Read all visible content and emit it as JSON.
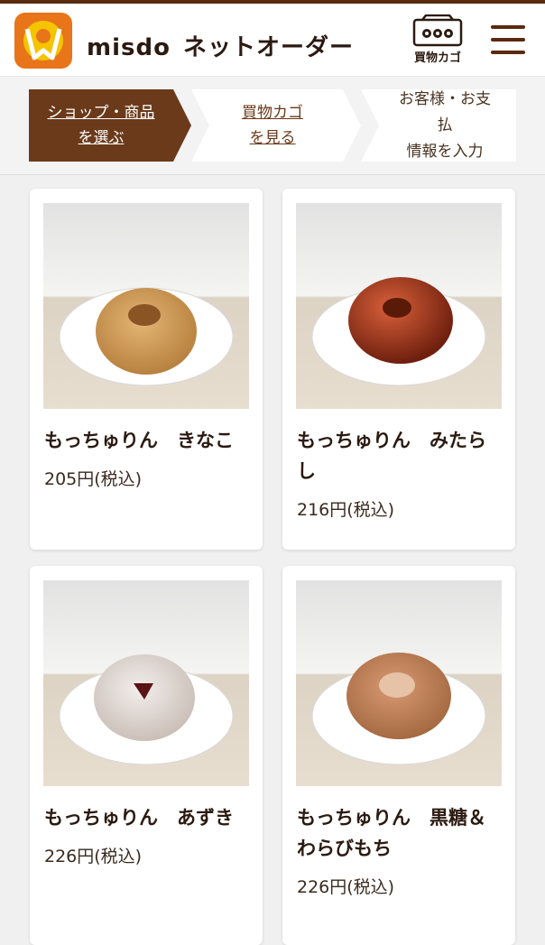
{
  "header": {
    "brand_prefix": "misdo",
    "brand_suffix": "ネットオーダー",
    "cart_label": "買物カゴ",
    "menu_icon": "hamburger-icon",
    "logo_icon": "misdo-logo"
  },
  "steps": [
    {
      "line1": "ショップ・商品",
      "line2": "を選ぶ",
      "active": true
    },
    {
      "line1": "買物カゴ",
      "line2": "を見る",
      "active": false
    },
    {
      "line1": "お客様・お支",
      "line2": "払",
      "line3": "情報を入力",
      "active": false
    }
  ],
  "products": [
    {
      "name": "もっちゅりん　きなこ",
      "price": "205円(税込)",
      "image_icon": "donut-kinako-photo"
    },
    {
      "name": "もっちゅりん　みたら\nし",
      "price": "216円(税込)",
      "image_icon": "donut-mitarashi-photo"
    },
    {
      "name": "もっちゅりん　あずき",
      "price": "226円(税込)",
      "image_icon": "donut-azuki-photo"
    },
    {
      "name": "もっちゅりん　黒糖＆\nわらびもち",
      "price": "226円(税込)",
      "image_icon": "donut-kokuto-warabi-photo"
    }
  ],
  "colors": {
    "brand_brown": "#6b3a1a",
    "logo_orange": "#e8751a",
    "logo_yellow": "#f5c400"
  }
}
